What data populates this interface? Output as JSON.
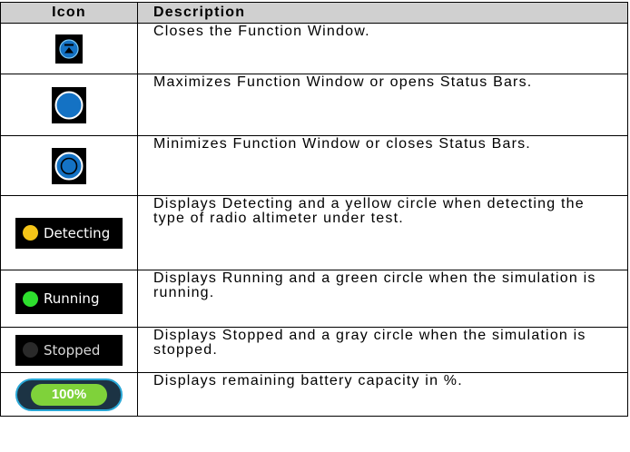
{
  "table": {
    "headers": {
      "icon": "Icon",
      "description": "Description"
    },
    "rows": [
      {
        "icon": "close-window-icon",
        "description": "Closes the Function Window."
      },
      {
        "icon": "maximize-window-icon",
        "description": "Maximizes Function Window or opens Status Bars."
      },
      {
        "icon": "minimize-window-icon",
        "description": "Minimizes Function Window or closes Status Bars."
      },
      {
        "icon": "detecting-status-icon",
        "icon_label": "Detecting",
        "description": "Displays Detecting and a yellow circle when detecting the type of radio altimeter under test."
      },
      {
        "icon": "running-status-icon",
        "icon_label": "Running",
        "description": "Displays Running and a green circle when the simulation is running."
      },
      {
        "icon": "stopped-status-icon",
        "icon_label": "Stopped",
        "description": "Displays Stopped and a gray circle when the simulation is stopped."
      },
      {
        "icon": "battery-icon",
        "icon_label": "100%",
        "battery_level": 1.0,
        "description": "Displays remaining battery capacity in %."
      }
    ]
  },
  "colors": {
    "header_background": "#d0d0d0",
    "window_button_blue": "#1472c4",
    "detecting_dot": "#f5c518",
    "running_dot": "#2ee02e",
    "stopped_dot": "#2a2a2a",
    "battery_fill": "#7fd23a",
    "battery_border": "#29a7d6"
  }
}
